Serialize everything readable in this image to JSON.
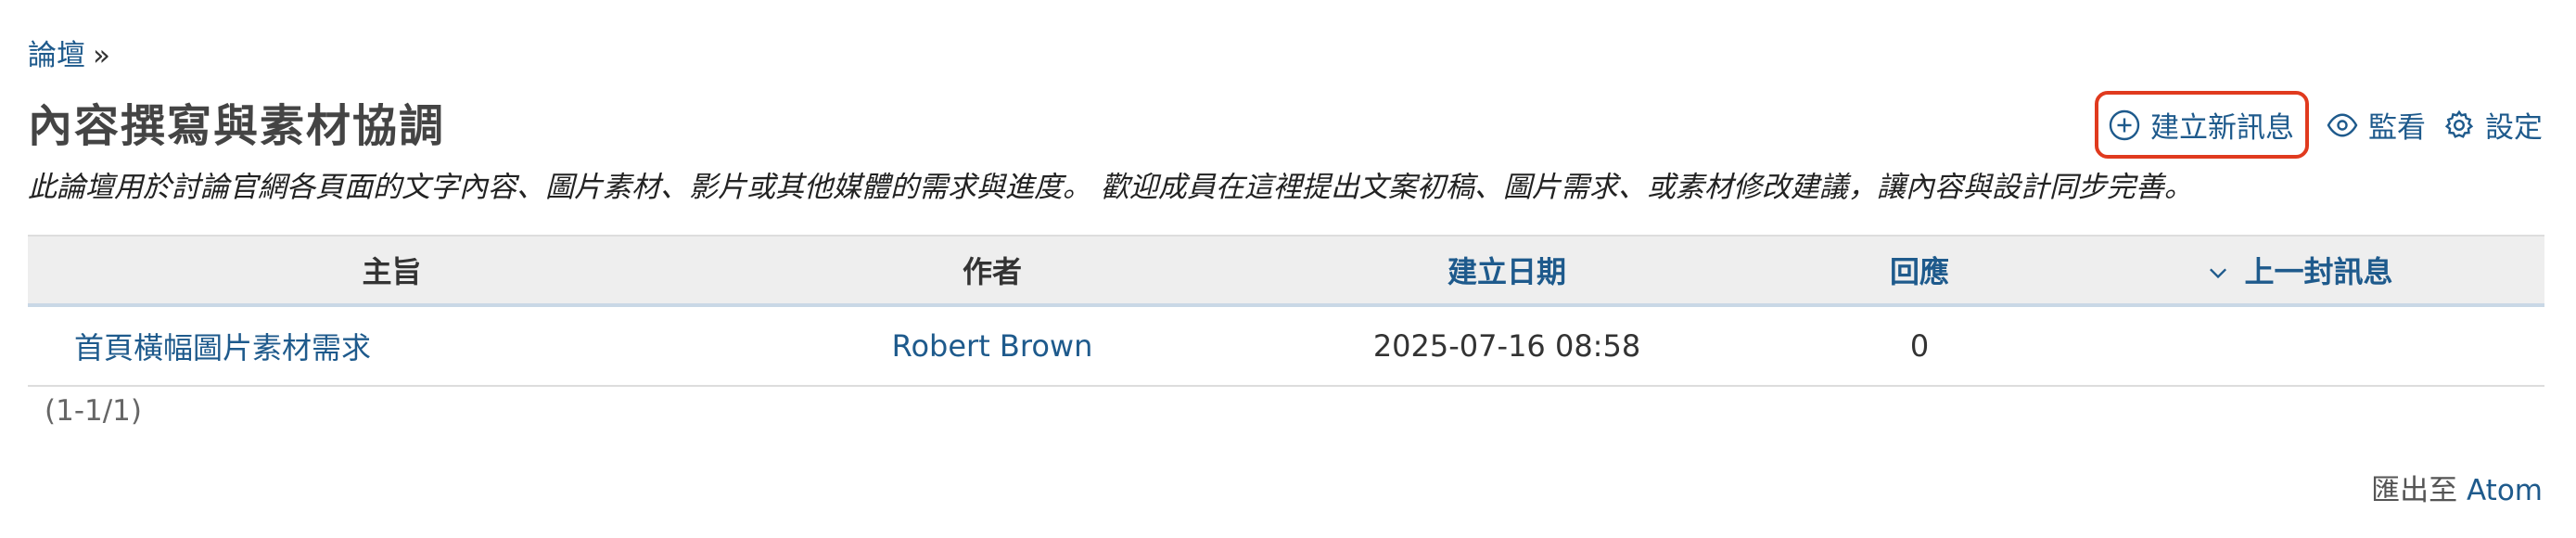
{
  "breadcrumb": {
    "link": "論壇",
    "separator": "»"
  },
  "page_title": "內容撰寫與素材協調",
  "contextual": {
    "new_message": "建立新訊息",
    "watch": "監看",
    "settings": "設定"
  },
  "description": "此論壇用於討論官網各頁面的文字內容、圖片素材、影片或其他媒體的需求與進度。 歡迎成員在這裡提出文案初稿、圖片需求、或素材修改建議，讓內容與設計同步完善。",
  "table": {
    "headers": {
      "subject": "主旨",
      "author": "作者",
      "created": "建立日期",
      "replies": "回應",
      "last_message": "上一封訊息"
    },
    "rows": [
      {
        "subject": "首頁橫幅圖片素材需求",
        "author": "Robert Brown",
        "created": "2025-07-16 08:58",
        "replies": "0",
        "last_message": ""
      }
    ]
  },
  "pagination": "(1-1/1)",
  "export": {
    "label": "匯出至",
    "link": "Atom"
  },
  "colors": {
    "link": "#1e5a8c",
    "highlight_border": "#e03a1e",
    "header_bg": "#eeeeee"
  },
  "icons": {
    "new_message": "plus-circle-icon",
    "watch": "eye-icon",
    "settings": "gear-icon",
    "sort": "chevron-down-icon"
  }
}
